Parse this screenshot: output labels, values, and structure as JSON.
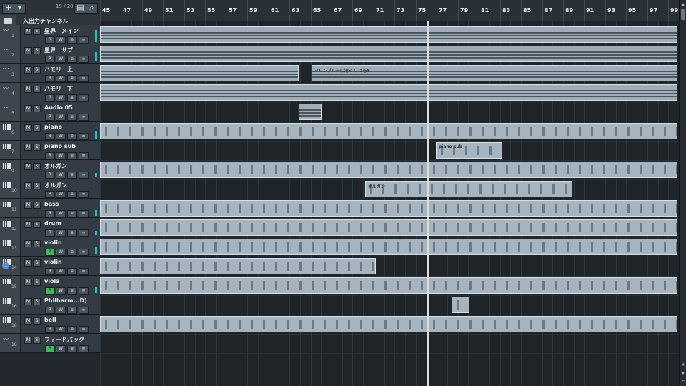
{
  "header": {
    "add_label": "+",
    "menu_label": "▾",
    "track_count": "19 / 20"
  },
  "folder": {
    "name": "入出力チャンネル"
  },
  "track_buttons": {
    "mute": "M",
    "solo": "S",
    "read": "R",
    "write": "W",
    "edit": "e",
    "link": "∞"
  },
  "tracks": [
    {
      "num": "1",
      "name": "星界　メイン",
      "type": "audio",
      "read_active": false,
      "meter": 0.8
    },
    {
      "num": "2",
      "name": "星界　サブ",
      "type": "audio",
      "read_active": false,
      "meter": 0.6
    },
    {
      "num": "3",
      "name": "ハモリ　上",
      "type": "audio",
      "read_active": false,
      "meter": 0
    },
    {
      "num": "4",
      "name": "ハモリ　下",
      "type": "audio",
      "read_active": false,
      "meter": 0
    },
    {
      "num": "5",
      "name": "Audio 05",
      "type": "audio",
      "read_active": false,
      "meter": 0
    },
    {
      "num": "6",
      "name": "piano",
      "type": "instrument",
      "read_active": false,
      "meter": 0.5
    },
    {
      "num": "7",
      "name": "piano sub",
      "type": "instrument",
      "read_active": false,
      "meter": 0
    },
    {
      "num": "9",
      "name": "オルガン",
      "type": "instrument",
      "read_active": false,
      "meter": 0.3
    },
    {
      "num": "10",
      "name": "オルガン",
      "type": "instrument",
      "read_active": false,
      "meter": 0
    },
    {
      "num": "11",
      "name": "bass",
      "type": "instrument",
      "read_active": false,
      "meter": 0.4
    },
    {
      "num": "12",
      "name": "drum",
      "type": "instrument",
      "read_active": false,
      "meter": 0.3
    },
    {
      "num": "13",
      "name": "violin",
      "type": "instrument",
      "read_active": true,
      "meter": 0.5
    },
    {
      "num": "14",
      "name": "violin",
      "type": "instrument",
      "read_active": false,
      "meter": 0
    },
    {
      "num": "15",
      "name": "viola",
      "type": "instrument",
      "read_active": true,
      "meter": 0.4
    },
    {
      "num": "16",
      "name": "Philharm...D)",
      "type": "instrument",
      "read_active": false,
      "meter": 0
    },
    {
      "num": "18",
      "name": "bell",
      "type": "instrument",
      "read_active": false,
      "meter": 0
    },
    {
      "num": "19",
      "name": "フィードバック",
      "type": "audio",
      "read_active": true,
      "meter": 0
    }
  ],
  "ruler": {
    "bars": [
      "45",
      "47",
      "49",
      "51",
      "53",
      "55",
      "57",
      "59",
      "61",
      "63",
      "65",
      "67",
      "69",
      "71",
      "73",
      "75",
      "77",
      "79",
      "81",
      "83",
      "85",
      "87",
      "89",
      "91",
      "93",
      "95",
      "97",
      "99"
    ]
  },
  "event_labels": {
    "hamori": "マリンブルーに沿って はも8",
    "piano_sub": "piano sub",
    "organ": "オルガン"
  },
  "timeline": {
    "first_bar": 45,
    "last_bar": 100,
    "playhead_bar": 76.1
  },
  "parts": [
    {
      "track": 0,
      "start": 45,
      "end": 100,
      "kind": "audio"
    },
    {
      "track": 1,
      "start": 45,
      "end": 100,
      "kind": "audio"
    },
    {
      "track": 2,
      "start": 45,
      "end": 63.9,
      "kind": "audio"
    },
    {
      "track": 2,
      "start": 65.1,
      "end": 100,
      "kind": "audio",
      "label": "hamori"
    },
    {
      "track": 3,
      "start": 45,
      "end": 100,
      "kind": "audio"
    },
    {
      "track": 4,
      "start": 63.9,
      "end": 66.1,
      "kind": "audio"
    },
    {
      "track": 5,
      "start": 45,
      "end": 100,
      "kind": "midi"
    },
    {
      "track": 6,
      "start": 76.9,
      "end": 83.2,
      "kind": "midi",
      "label": "piano_sub"
    },
    {
      "track": 7,
      "start": 45,
      "end": 100,
      "kind": "midi"
    },
    {
      "track": 8,
      "start": 70.2,
      "end": 89.9,
      "kind": "midi",
      "label": "organ"
    },
    {
      "track": 9,
      "start": 45,
      "end": 100,
      "kind": "midi"
    },
    {
      "track": 10,
      "start": 45,
      "end": 100,
      "kind": "midi"
    },
    {
      "track": 11,
      "start": 45,
      "end": 100,
      "kind": "midi"
    },
    {
      "track": 12,
      "start": 45,
      "end": 71.2,
      "kind": "midi"
    },
    {
      "track": 13,
      "start": 45,
      "end": 100,
      "kind": "midi"
    },
    {
      "track": 14,
      "start": 78.4,
      "end": 80.1,
      "kind": "midi"
    },
    {
      "track": 15,
      "start": 45,
      "end": 100,
      "kind": "midi"
    }
  ],
  "colors": {
    "part": "#a6b4bf",
    "meter": "#17c7c7",
    "read_active": "#3bbf55",
    "background": "#1e2428"
  },
  "icons": {
    "folder": "folder-icon",
    "audio": "waveform-icon",
    "instrument": "piano-keys-icon",
    "search": "search-icon",
    "expand": "expand-icon"
  }
}
